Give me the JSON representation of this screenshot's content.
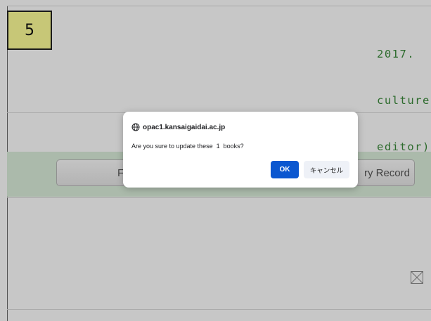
{
  "step_badge": {
    "label": "5"
  },
  "citation": {
    "lines": [
      "2017.",
      "culture",
      "editor)"
    ]
  },
  "background_buttons": {
    "left_partial_label": "F",
    "right_partial_label": "ry Record"
  },
  "dialog": {
    "origin": "opac1.kansaigaidai.ac.jp",
    "message": "Are you sure to update these  1  books?",
    "ok_label": "OK",
    "cancel_label": "キャンセル"
  },
  "colors": {
    "accent": "#0b57d0",
    "citation_text": "#3a8a3a",
    "green_band": "#dcefdc",
    "badge": "#ffff99"
  }
}
